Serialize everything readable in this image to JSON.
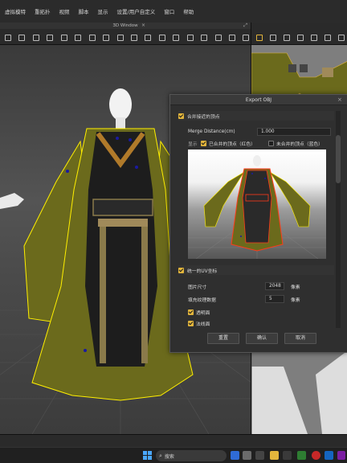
{
  "menu": [
    "虚拟模特",
    "重拓扑",
    "视频",
    "脚本",
    "显示",
    "设置/用户自定义",
    "窗口",
    "帮助"
  ],
  "viewport": {
    "title": "3D Window"
  },
  "dialog": {
    "title": "Export OBJ",
    "section1": {
      "label": "合并接近的顶点",
      "checked": true
    },
    "merge_distance": {
      "label": "Merge Distance(cm)",
      "value": "1.000"
    },
    "display": {
      "label": "显示",
      "opt_merged": {
        "label": "已合并的顶点（红色）",
        "checked": true
      },
      "opt_unmerged": {
        "label": "未合并的顶点（蓝色）",
        "checked": false
      }
    },
    "section2": {
      "label": "统一的UV坐标",
      "checked": true
    },
    "image_size": {
      "label": "图片尺寸",
      "value": "2048",
      "unit": "像素"
    },
    "padding": {
      "label": "填充纹理数据",
      "value": "5",
      "unit": "像素"
    },
    "option1": {
      "label": "透明面",
      "checked": true
    },
    "option2": {
      "label": "法线面",
      "checked": true
    },
    "buttons": {
      "reset": "重置",
      "ok": "确认",
      "cancel": "取消"
    }
  },
  "taskbar": {
    "search_placeholder": "搜索"
  },
  "colors": {
    "accent": "#e2b53c",
    "garment": "#6b6a1c",
    "selection": "#ffef00"
  }
}
